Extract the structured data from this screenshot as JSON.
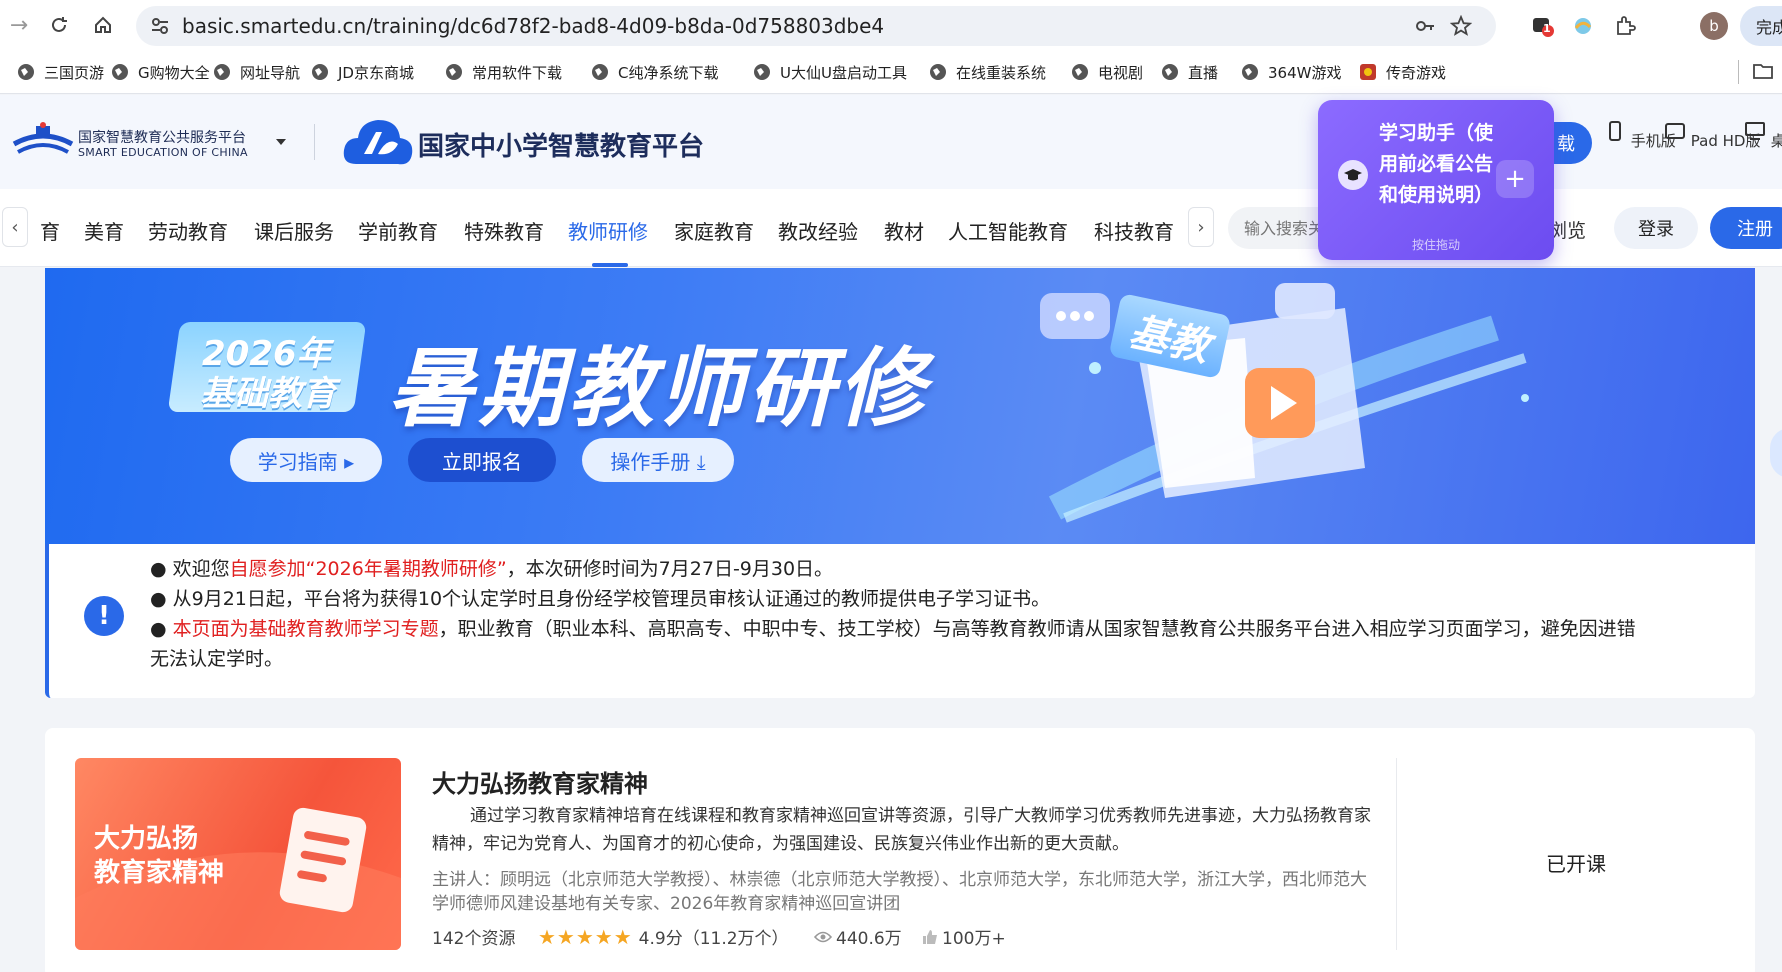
{
  "browser": {
    "url": "basic.smartedu.cn/training/dc6d78f2-bad8-4d09-b8da-0d758803dbe4",
    "ext_badge": "1",
    "profile_initial": "b",
    "finish_label": "完成"
  },
  "bookmarks": [
    "三国页游",
    "G购物大全",
    "网址导航",
    "JD京东商城",
    "常用软件下载",
    "C纯净系统下载",
    "U大仙U盘启动工具",
    "在线重装系统",
    "电视剧",
    "直播",
    "364W游戏",
    "传奇游戏"
  ],
  "header": {
    "org_name": "国家智慧教育公共服务平台",
    "org_name_en": "SMART EDUCATION OF CHINA",
    "site_title": "国家中小学智慧教育平台",
    "download_label": "载",
    "devices": [
      "手机版",
      "Pad HD版",
      "桌面端"
    ]
  },
  "nav": {
    "tabs": [
      "育",
      "美育",
      "劳动教育",
      "课后服务",
      "学前教育",
      "特殊教育",
      "教师研修",
      "家庭教育",
      "教改经验",
      "教材",
      "人工智能教育",
      "科技教育"
    ],
    "active": "教师研修",
    "search_placeholder": "输入搜索关键词",
    "browse": "浏览",
    "login": "登录",
    "register": "注册"
  },
  "helper": {
    "title": "学习助手（使用前必看公告和使用说明）",
    "drag_hint": "按住拖动"
  },
  "banner": {
    "badge_line1": "2026年",
    "badge_line2": "基础教育",
    "title": "暑期教师研修",
    "book_tag": "基教",
    "buttons": [
      "学习指南 ▸",
      "立即报名",
      "操作手册 ⤓"
    ]
  },
  "notice": {
    "l1_pre": "● 欢迎您",
    "l1_red": "自愿参加“2026年暑期教师研修”",
    "l1_post": "，本次研修时间为7月27日-9月30日。",
    "l2": "● 从9月21日起，平台将为获得10个认定学时且身份经学校管理员审核认证通过的教师提供电子学习证书。",
    "l3_pre": "● ",
    "l3_red": "本页面为基础教育教师学习专题",
    "l3_post": "，职业教育（职业本科、高职高专、中职中专、技工学校）与高等教育教师请从国家智慧教育公共服务平台进入相应学习页面学习，避免因进错",
    "l4": "无法认定学时。"
  },
  "course": {
    "thumb_line1": "大力弘扬",
    "thumb_line2": "教育家精神",
    "title": "大力弘扬教育家精神",
    "description": "通过学习教育家精神培育在线课程和教育家精神巡回宣讲等资源，引导广大教师学习优秀教师先进事迹，大力弘扬教育家精神，牢记为党育人、为国育才的初心使命，为强国建设、民族复兴伟业作出新的更大贡献。",
    "speakers": "主讲人：顾明远（北京师范大学教授）、林崇德（北京师范大学教授）、北京师范大学，东北师范大学，浙江大学，西北师范大学师德师风建设基地有关专家、2026年教育家精神巡回宣讲团",
    "resources": "142个资源",
    "stars": "★★★★★",
    "rating": "4.9分（11.2万个）",
    "views": "440.6万",
    "likes": "100万+",
    "status": "已开课"
  },
  "colors": {
    "accent": "#2a69e8",
    "red": "#e02020",
    "helper": "#7a58f5"
  }
}
